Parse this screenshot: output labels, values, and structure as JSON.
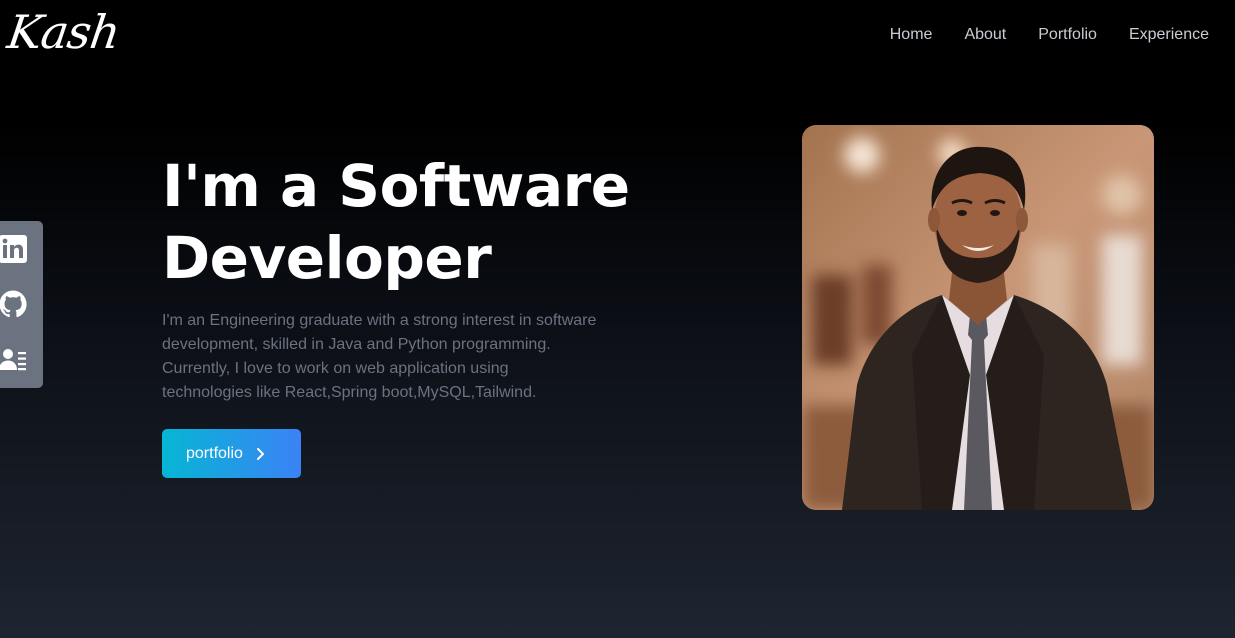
{
  "brand": {
    "logo_text": "Kash"
  },
  "nav": {
    "items": [
      {
        "label": "Home"
      },
      {
        "label": "About"
      },
      {
        "label": "Portfolio"
      },
      {
        "label": "Experience"
      }
    ]
  },
  "social": {
    "icons": [
      "linkedin-icon",
      "github-icon",
      "resume-icon"
    ]
  },
  "hero": {
    "title_line1": "I'm a Software",
    "title_line2": "Developer",
    "description": "I'm an Engineering graduate with a strong interest in software development, skilled in Java and Python programming. Currently, I love to work on web application using technologies like React,Spring boot,MySQL,Tailwind.",
    "cta_label": "portfolio",
    "cta_icon": "chevron-right-icon"
  },
  "colors": {
    "accent_start": "#06b6d4",
    "accent_end": "#3b82f6",
    "social_bar": "#6b7280",
    "muted_text": "#6b7280"
  }
}
